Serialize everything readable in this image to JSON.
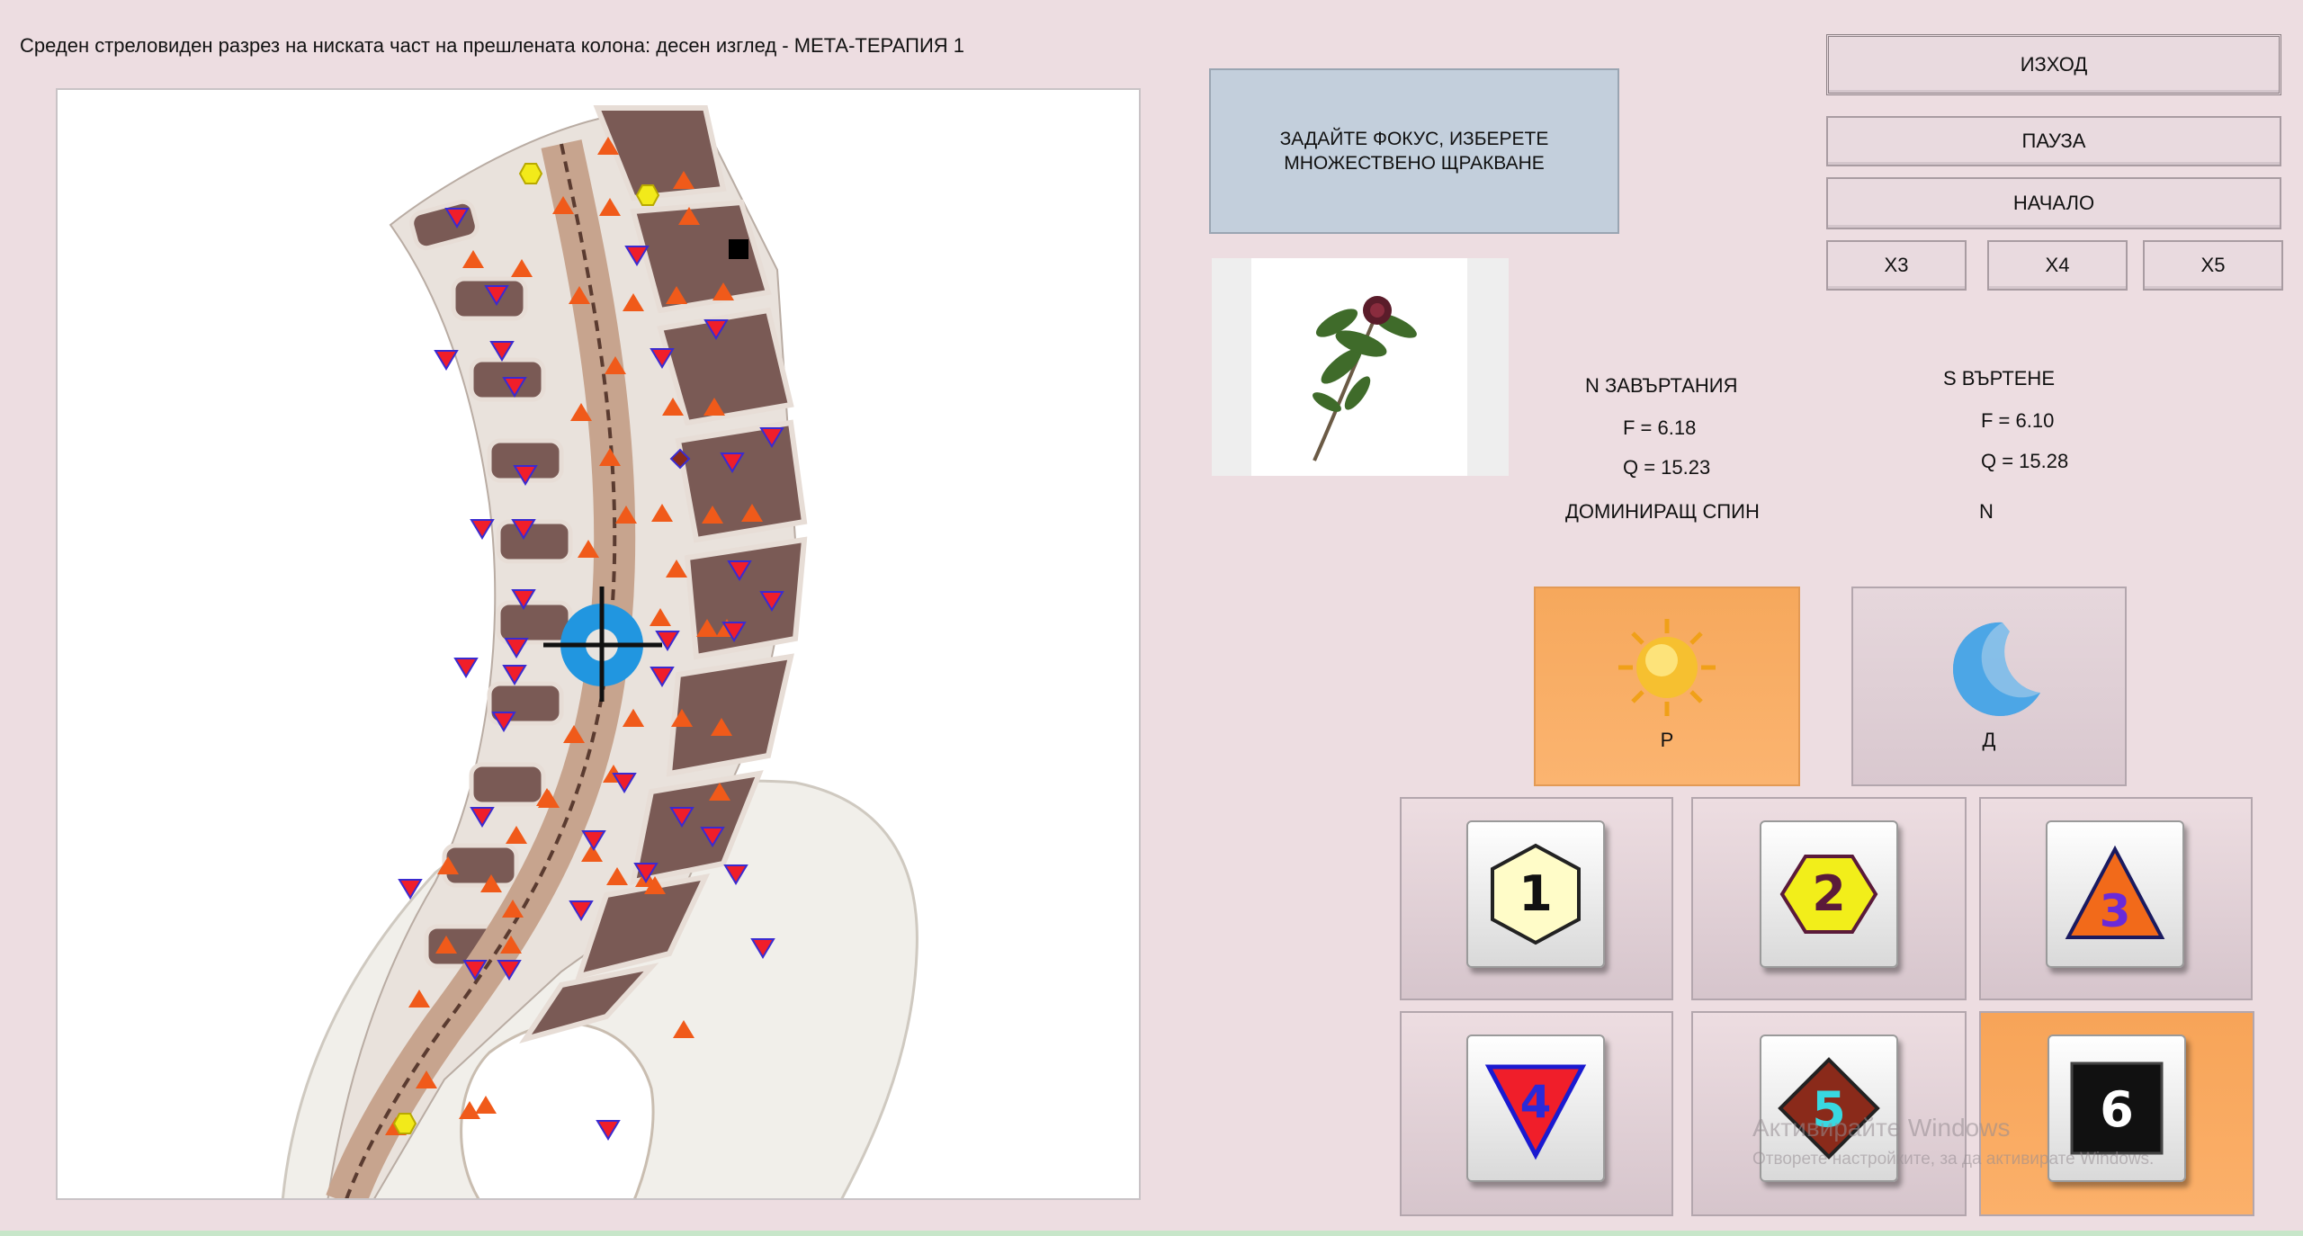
{
  "window": {
    "title": "Среден стреловиден разрез на ниската част на прешлената колона: десен изглед - МЕТА-ТЕРАПИЯ 1"
  },
  "controls": {
    "exit": "ИЗХОД",
    "pause": "ПАУЗА",
    "start": "НАЧАЛО",
    "x3": "Х3",
    "x4": "Х4",
    "x5": "Х5"
  },
  "focus_box": {
    "line1": "ЗАДАЙТЕ ФОКУС, ИЗБЕРЕТЕ",
    "line2": "МНОЖЕСТВЕНО ЩРАКВАНЕ"
  },
  "stats": {
    "n_title": "N ЗАВЪРТАНИЯ",
    "n_f": "F =  6.18",
    "n_q": "Q = 15.23",
    "s_title": "S ВЪРТЕНЕ",
    "s_f": "F =  6.10",
    "s_q": "Q = 15.28",
    "dominant_label": "ДОМИНИРАЩ СПИН",
    "dominant_value": "N"
  },
  "modes": {
    "day": "Р",
    "night": "Д"
  },
  "symbols": [
    {
      "num": "1",
      "shape": "hexagon-light"
    },
    {
      "num": "2",
      "shape": "hexagon-yellow"
    },
    {
      "num": "3",
      "shape": "triangle-up"
    },
    {
      "num": "4",
      "shape": "triangle-down"
    },
    {
      "num": "5",
      "shape": "diamond"
    },
    {
      "num": "6",
      "shape": "square-black",
      "selected": true
    }
  ],
  "watermark": {
    "line1": "Активирайте Windows",
    "line2": "Отворете настройките, за да активирате Windows."
  },
  "colors": {
    "background": "#eddde1",
    "accent": "#f6a85c",
    "focus_box": "#c3cfdc"
  }
}
